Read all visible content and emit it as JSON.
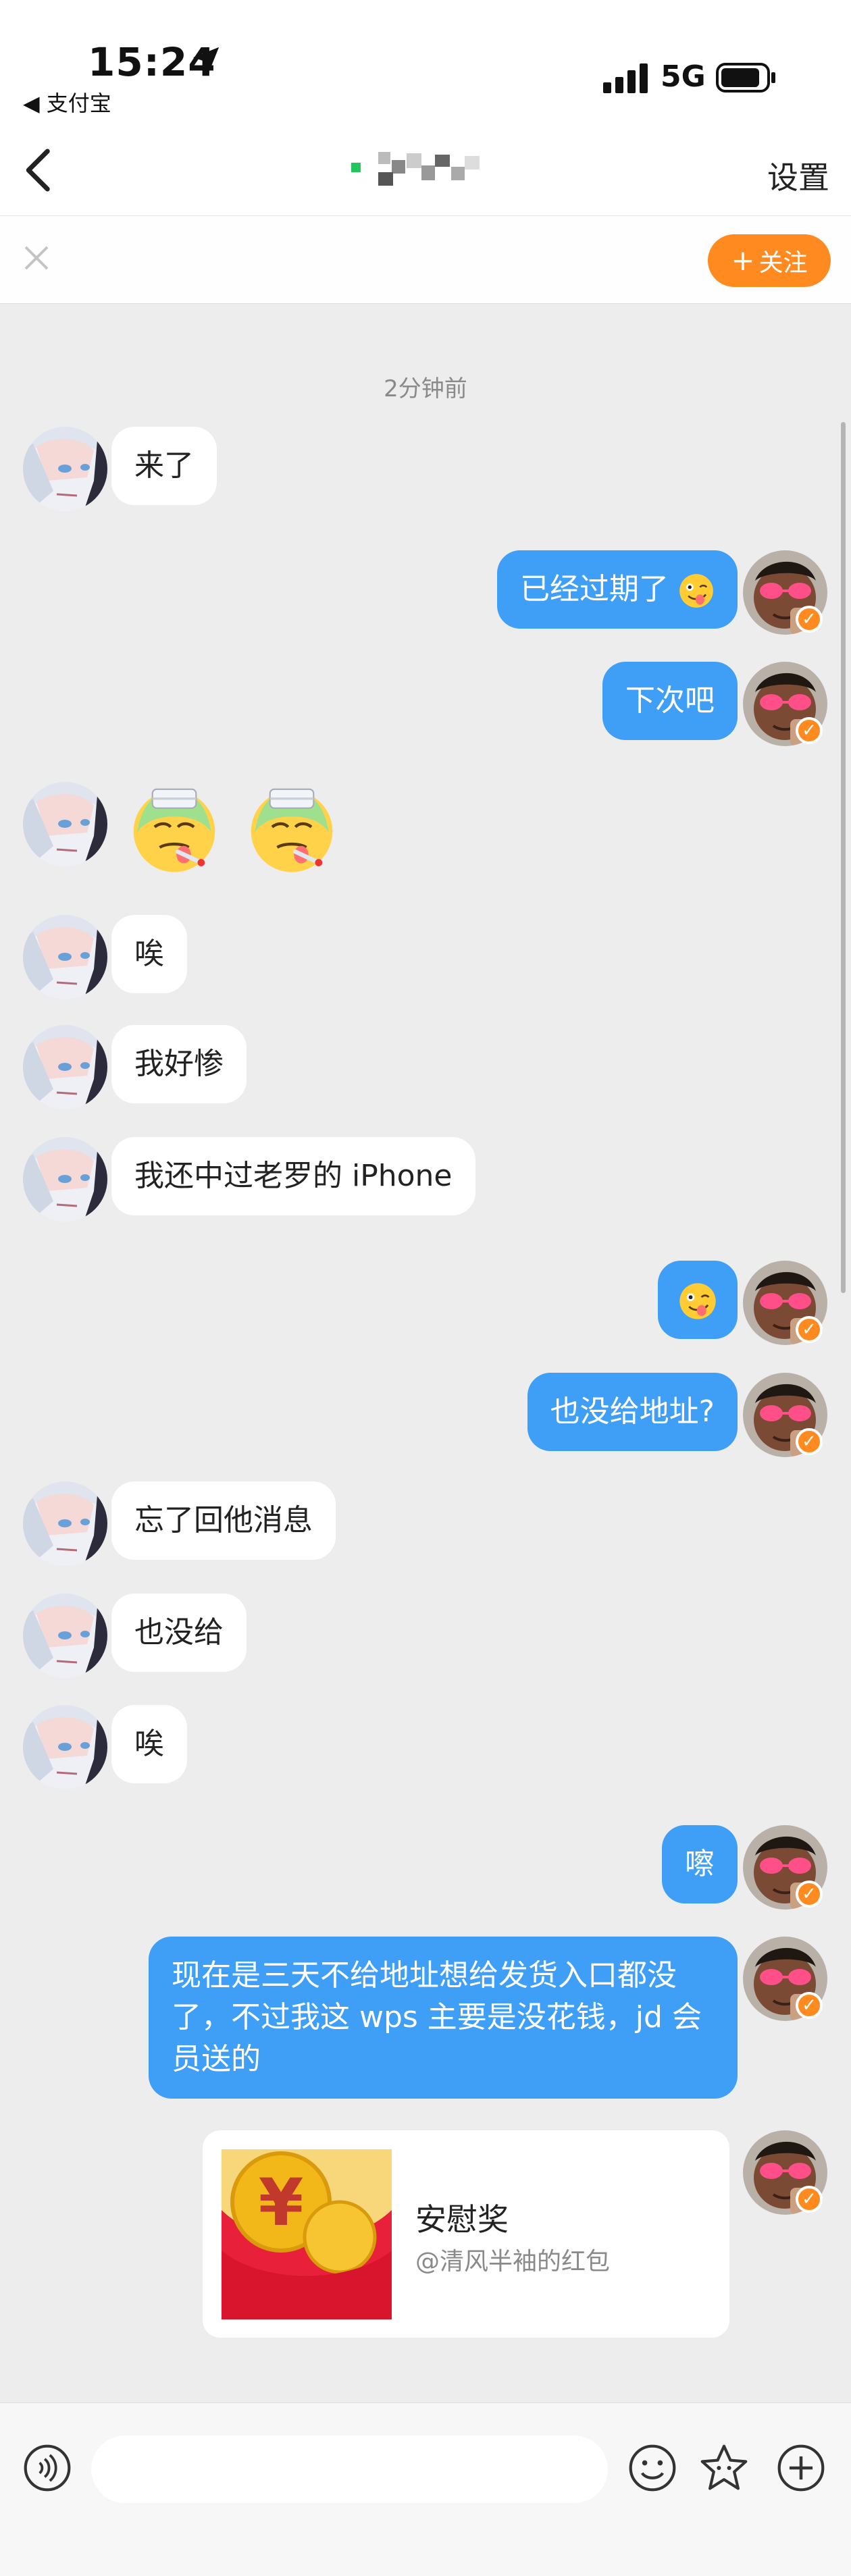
{
  "status_bar": {
    "time": "15:24",
    "back_app": "◀ 支付宝",
    "network": "5G"
  },
  "nav": {
    "settings": "设置"
  },
  "follow_strip": {
    "follow_label": "关注"
  },
  "time_separator": "2分钟前",
  "messages": [
    {
      "side": "in",
      "text": "来了"
    },
    {
      "side": "out",
      "text": "已经过期了"
    },
    {
      "side": "out",
      "text": "下次吧"
    },
    {
      "side": "in",
      "text": ""
    },
    {
      "side": "in",
      "text": "唉"
    },
    {
      "side": "in",
      "text": "我好惨"
    },
    {
      "side": "in",
      "text": "我还中过老罗的 iPhone"
    },
    {
      "side": "out",
      "text": ""
    },
    {
      "side": "out",
      "text": "也没给地址?"
    },
    {
      "side": "in",
      "text": "忘了回他消息"
    },
    {
      "side": "in",
      "text": "也没给"
    },
    {
      "side": "in",
      "text": "唉"
    },
    {
      "side": "out",
      "text": "嚓"
    },
    {
      "side": "out",
      "text": "现在是三天不给地址想给发货入口都没了，不过我这 wps 主要是没花钱，jd 会员送的"
    }
  ],
  "red_packet": {
    "title": "安慰奖",
    "subtitle": "@清风半袖的红包",
    "currency_symbol": "¥"
  },
  "colors": {
    "bubble_out": "#3f9ef5",
    "accent": "#ff8a1f",
    "background": "#ededed"
  },
  "icons": {
    "voice": "voice-icon",
    "emoji": "emoji-icon",
    "sticker": "sticker-icon",
    "add": "plus-circle-icon"
  }
}
